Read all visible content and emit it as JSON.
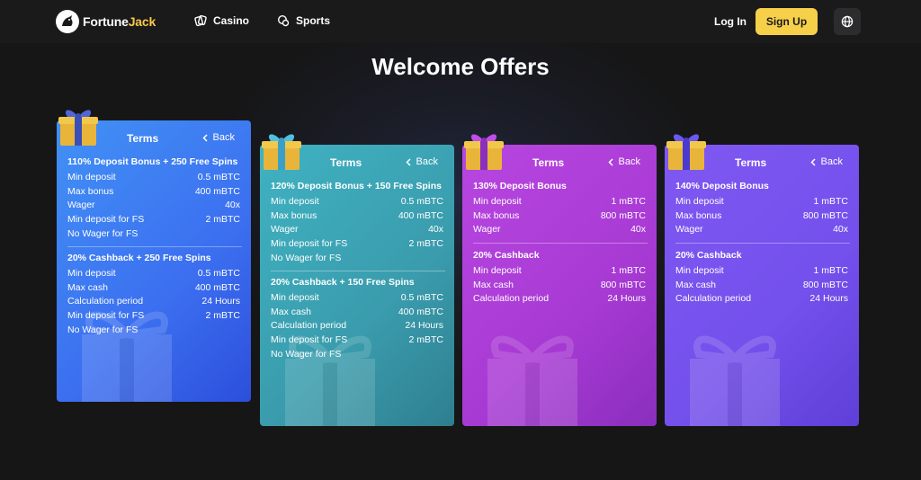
{
  "header": {
    "logo_text_1": "Fortune",
    "logo_text_2": "Jack",
    "nav": [
      {
        "label": "Casino"
      },
      {
        "label": "Sports"
      }
    ],
    "login_label": "Log In",
    "signup_label": "Sign Up",
    "colors": {
      "accent": "#f7d04a",
      "background": "#161616"
    }
  },
  "page": {
    "title": "Welcome Offers"
  },
  "cards": [
    {
      "terms_label": "Terms",
      "back_label": "Back",
      "color": "#3a7df0",
      "sections": [
        {
          "title": "110% Deposit Bonus + 250 Free Spins",
          "rows": [
            {
              "label": "Min deposit",
              "value": "0.5 mBTC"
            },
            {
              "label": "Max bonus",
              "value": "400 mBTC"
            },
            {
              "label": "Wager",
              "value": "40x"
            },
            {
              "label": "Min deposit for FS",
              "value": "2 mBTC"
            },
            {
              "label": "No Wager for FS",
              "value": ""
            }
          ]
        },
        {
          "title": "20% Cashback + 250 Free Spins",
          "rows": [
            {
              "label": "Min deposit",
              "value": "0.5 mBTC"
            },
            {
              "label": "Max cash",
              "value": "400 mBTC"
            },
            {
              "label": "Calculation period",
              "value": "24 Hours"
            },
            {
              "label": "Min deposit for FS",
              "value": "2 mBTC"
            },
            {
              "label": "No Wager for FS",
              "value": ""
            }
          ]
        }
      ]
    },
    {
      "terms_label": "Terms",
      "back_label": "Back",
      "color": "#3aa7b5",
      "sections": [
        {
          "title": "120% Deposit Bonus + 150 Free Spins",
          "rows": [
            {
              "label": "Min deposit",
              "value": "0.5 mBTC"
            },
            {
              "label": "Max bonus",
              "value": "400 mBTC"
            },
            {
              "label": "Wager",
              "value": "40x"
            },
            {
              "label": "Min deposit for FS",
              "value": "2 mBTC"
            },
            {
              "label": "No Wager for FS",
              "value": ""
            }
          ]
        },
        {
          "title": "20% Cashback + 150 Free Spins",
          "rows": [
            {
              "label": "Min deposit",
              "value": "0.5 mBTC"
            },
            {
              "label": "Max cash",
              "value": "400 mBTC"
            },
            {
              "label": "Calculation period",
              "value": "24 Hours"
            },
            {
              "label": "Min deposit for FS",
              "value": "2 mBTC"
            },
            {
              "label": "No Wager for FS",
              "value": ""
            }
          ]
        }
      ]
    },
    {
      "terms_label": "Terms",
      "back_label": "Back",
      "color": "#b03ed8",
      "sections": [
        {
          "title": "130% Deposit Bonus",
          "rows": [
            {
              "label": "Min deposit",
              "value": "1 mBTC"
            },
            {
              "label": "Max bonus",
              "value": "800 mBTC"
            },
            {
              "label": "Wager",
              "value": "40x"
            }
          ]
        },
        {
          "title": "20% Cashback",
          "rows": [
            {
              "label": "Min deposit",
              "value": "1 mBTC"
            },
            {
              "label": "Max cash",
              "value": "800 mBTC"
            },
            {
              "label": "Calculation period",
              "value": "24 Hours"
            }
          ]
        }
      ]
    },
    {
      "terms_label": "Terms",
      "back_label": "Back",
      "color": "#7a52ee",
      "sections": [
        {
          "title": "140% Deposit Bonus",
          "rows": [
            {
              "label": "Min deposit",
              "value": "1 mBTC"
            },
            {
              "label": "Max bonus",
              "value": "800 mBTC"
            },
            {
              "label": "Wager",
              "value": "40x"
            }
          ]
        },
        {
          "title": "20% Cashback",
          "rows": [
            {
              "label": "Min deposit",
              "value": "1 mBTC"
            },
            {
              "label": "Max cash",
              "value": "800 mBTC"
            },
            {
              "label": "Calculation period",
              "value": "24 Hours"
            }
          ]
        }
      ]
    }
  ]
}
